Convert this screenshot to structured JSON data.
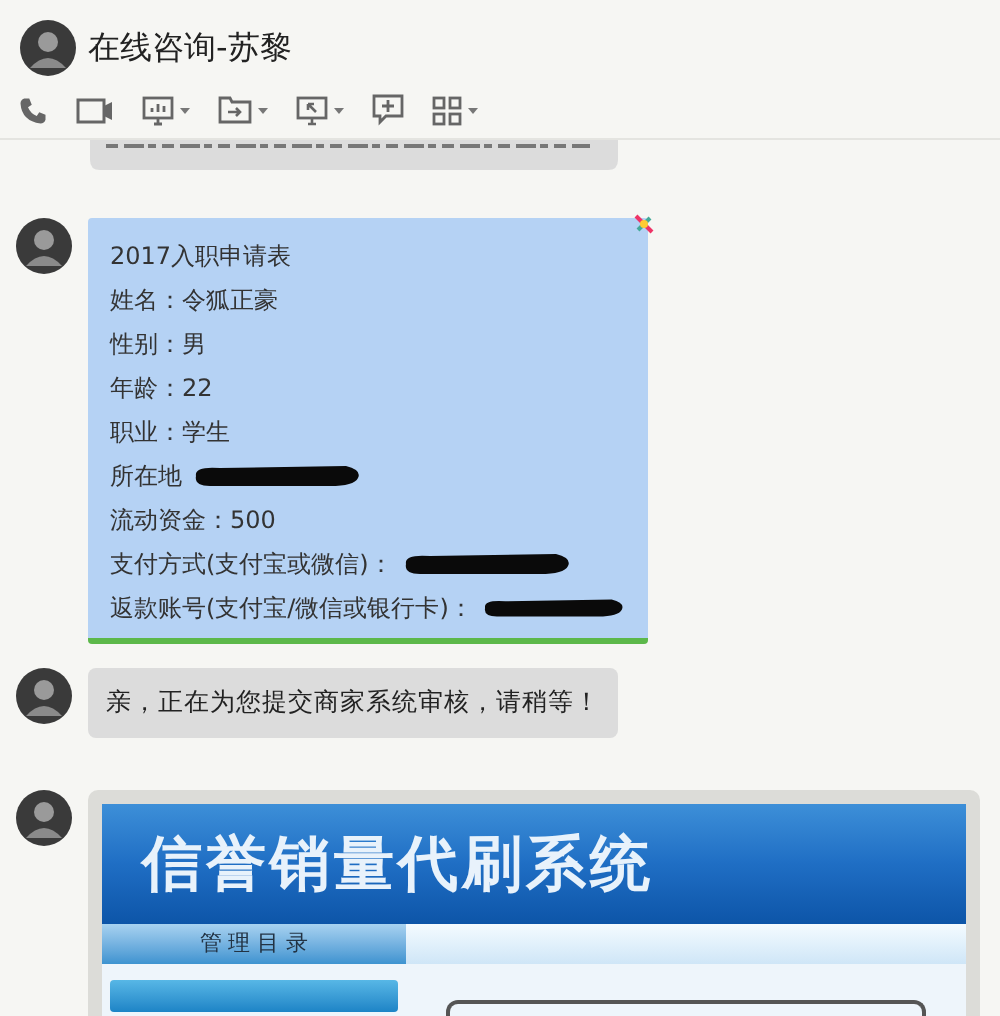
{
  "window": {
    "title": "在线咨询-苏黎"
  },
  "messages": [
    {
      "kind": "partial"
    },
    {
      "kind": "form",
      "lines": [
        {
          "text": "2017入职申请表",
          "redacted": false
        },
        {
          "text": "姓名：令狐正豪",
          "redacted": false
        },
        {
          "text": "性别：男",
          "redacted": false
        },
        {
          "text": "年龄：22",
          "redacted": false
        },
        {
          "text": "职业：学生",
          "redacted": false
        },
        {
          "text": "所在地",
          "redacted": true
        },
        {
          "text": "流动资金：500",
          "redacted": false
        },
        {
          "text": "支付方式(支付宝或微信)：",
          "redacted": true
        },
        {
          "text": "返款账号(支付宝/微信或银行卡)：",
          "redacted": true
        }
      ]
    },
    {
      "kind": "text",
      "text": "亲，正在为您提交商家系统审核，请稍等！"
    },
    {
      "kind": "screenshot",
      "title": "信誉销量代刷系统",
      "menu_heading": "管 理 目 录"
    }
  ]
}
